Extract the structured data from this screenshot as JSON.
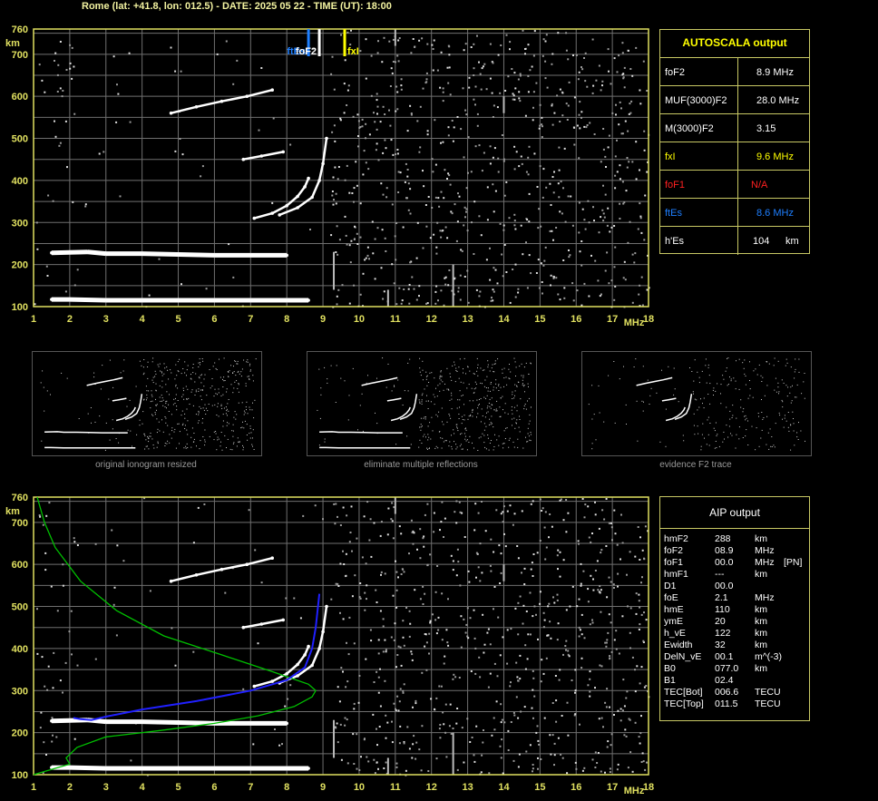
{
  "header": {
    "title": "Rome (lat: +41.8, lon: 012.5) - DATE: 2025 05 22 - TIME (UT): 18:00"
  },
  "colors": {
    "frame": "#e0e060",
    "grid": "#6f6f6f",
    "trace": "#ffffff",
    "noise": "#9a9a9a",
    "fxl": "#ffff00",
    "ftEs": "#1e7fff",
    "foF1": "#ff2020",
    "profile": "#00c000",
    "aip": "#2020ff"
  },
  "ionogram": {
    "y_unit": "km",
    "x_unit": "MHz",
    "x_ticks": [
      "1",
      "2",
      "3",
      "4",
      "5",
      "6",
      "7",
      "8",
      "9",
      "10",
      "11",
      "12",
      "13",
      "14",
      "15",
      "16",
      "17",
      "18"
    ],
    "y_ticks": [
      "100",
      "200",
      "300",
      "400",
      "500",
      "600",
      "700",
      "760"
    ],
    "markers": [
      {
        "label": "ftEs",
        "freq": 8.6,
        "color": "#1e7fff"
      },
      {
        "label": "foF2",
        "freq": 8.9,
        "color": "#ffffff"
      },
      {
        "label": "fxI",
        "freq": 9.6,
        "color": "#ffff00"
      }
    ]
  },
  "autoscala": {
    "title": "AUTOSCALA output",
    "rows": [
      {
        "name": "foF2",
        "value": "8.9 MHz",
        "color": "#ffffff"
      },
      {
        "name": "MUF(3000)F2",
        "value": "28.0 MHz",
        "color": "#ffffff"
      },
      {
        "name": "M(3000)F2",
        "value": "3.15",
        "color": "#ffffff"
      },
      {
        "name": "fxI",
        "value": "9.6 MHz",
        "color": "#ffff00"
      },
      {
        "name": "foF1",
        "value": "N/A",
        "color": "#ff2020"
      },
      {
        "name": "ftEs",
        "value": "8.6 MHz",
        "color": "#1e7fff"
      },
      {
        "name": "h'Es",
        "value": "104",
        "unit": "km",
        "color": "#ffffff"
      }
    ]
  },
  "thumbnails": [
    {
      "caption": "original ionogram resized"
    },
    {
      "caption": "eliminate multiple reflections"
    },
    {
      "caption": "evidence F2 trace"
    }
  ],
  "aip": {
    "title": "AIP output",
    "rows": [
      {
        "name": "hmF2",
        "value": "288",
        "unit": "km",
        "extra": ""
      },
      {
        "name": "foF2",
        "value": "08.9",
        "unit": "MHz",
        "extra": ""
      },
      {
        "name": "foF1",
        "value": "00.0",
        "unit": "MHz",
        "extra": "[PN]"
      },
      {
        "name": "hmF1",
        "value": "---",
        "unit": "km",
        "extra": ""
      },
      {
        "name": "D1",
        "value": "00.0",
        "unit": "",
        "extra": ""
      },
      {
        "name": "foE",
        "value": "2.1",
        "unit": "MHz",
        "extra": ""
      },
      {
        "name": "hmE",
        "value": "110",
        "unit": "km",
        "extra": ""
      },
      {
        "name": "ymE",
        "value": "20",
        "unit": "km",
        "extra": ""
      },
      {
        "name": "h_vE",
        "value": "122",
        "unit": "km",
        "extra": ""
      },
      {
        "name": "Ewidth",
        "value": "32",
        "unit": "km",
        "extra": ""
      },
      {
        "name": "DelN_vE",
        "value": "00.1",
        "unit": "m^(-3)",
        "extra": ""
      },
      {
        "name": "B0",
        "value": "077.0",
        "unit": "km",
        "extra": ""
      },
      {
        "name": "B1",
        "value": "02.4",
        "unit": "",
        "extra": ""
      },
      {
        "name": "TEC[Bot]",
        "value": "006.6",
        "unit": "TECU",
        "extra": ""
      },
      {
        "name": "TEC[Top]",
        "value": "011.5",
        "unit": "TECU",
        "extra": ""
      }
    ]
  },
  "chart_data": [
    {
      "type": "scatter",
      "title": "Rome (lat: +41.8, lon: 012.5) - DATE: 2025 05 22 - TIME (UT): 18:00",
      "xlabel": "MHz",
      "ylabel": "km",
      "xlim": [
        1,
        18
      ],
      "ylim": [
        100,
        760
      ],
      "grid": true,
      "series": [
        {
          "values": [
            [
              1.5,
              117
            ],
            [
              2,
              117
            ],
            [
              3,
              115
            ],
            [
              4,
              115
            ],
            [
              5,
              115
            ],
            [
              6,
              115
            ],
            [
              7,
              115
            ],
            [
              8,
              115
            ],
            [
              8.6,
              115
            ]
          ]
        },
        {
          "values": [
            [
              1.5,
              228
            ],
            [
              2.5,
              230
            ],
            [
              3,
              226
            ],
            [
              4,
              226
            ],
            [
              5,
              224
            ],
            [
              6,
              222
            ],
            [
              7,
              222
            ],
            [
              8,
              222
            ]
          ]
        },
        {
          "values": [
            [
              7.1,
              310
            ],
            [
              7.6,
              322
            ],
            [
              8.0,
              340
            ],
            [
              8.3,
              362
            ],
            [
              8.5,
              385
            ],
            [
              8.6,
              405
            ]
          ]
        },
        {
          "values": [
            [
              7.8,
              318
            ],
            [
              8.3,
              335
            ],
            [
              8.7,
              360
            ],
            [
              8.9,
              400
            ],
            [
              9.0,
              440
            ],
            [
              9.1,
              500
            ]
          ]
        },
        {
          "values": [
            [
              4.8,
              560
            ],
            [
              5.5,
              575
            ],
            [
              6.2,
              588
            ],
            [
              6.9,
              600
            ],
            [
              7.6,
              615
            ]
          ]
        },
        {
          "values": [
            [
              6.8,
              450
            ],
            [
              7.3,
              458
            ],
            [
              7.9,
              468
            ]
          ]
        }
      ]
    },
    {
      "type": "line",
      "xlabel": "MHz",
      "ylabel": "km",
      "xlim": [
        1,
        18
      ],
      "ylim": [
        100,
        760
      ],
      "grid": true,
      "series": [
        {
          "values": [
            [
              1.0,
              100
            ],
            [
              1.6,
              115
            ],
            [
              2.0,
              125
            ],
            [
              1.9,
              140
            ],
            [
              2.2,
              165
            ],
            [
              3.0,
              190
            ],
            [
              4.5,
              205
            ],
            [
              6.0,
              222
            ],
            [
              7.2,
              240
            ],
            [
              8.2,
              262
            ],
            [
              8.7,
              285
            ],
            [
              8.8,
              300
            ],
            [
              8.6,
              315
            ],
            [
              7.6,
              345
            ],
            [
              6.2,
              385
            ],
            [
              4.6,
              430
            ],
            [
              3.3,
              490
            ],
            [
              2.3,
              560
            ],
            [
              1.6,
              640
            ],
            [
              1.3,
              700
            ],
            [
              1.1,
              760
            ]
          ]
        },
        {
          "values": [
            [
              2.1,
              235
            ],
            [
              2.3,
              232
            ],
            [
              2.6,
              230
            ],
            [
              3.0,
              238
            ],
            [
              4.0,
              255
            ],
            [
              5.5,
              275
            ],
            [
              7.0,
              300
            ],
            [
              8.0,
              325
            ],
            [
              8.5,
              355
            ],
            [
              8.7,
              400
            ],
            [
              8.8,
              450
            ],
            [
              8.9,
              530
            ]
          ]
        }
      ]
    }
  ]
}
